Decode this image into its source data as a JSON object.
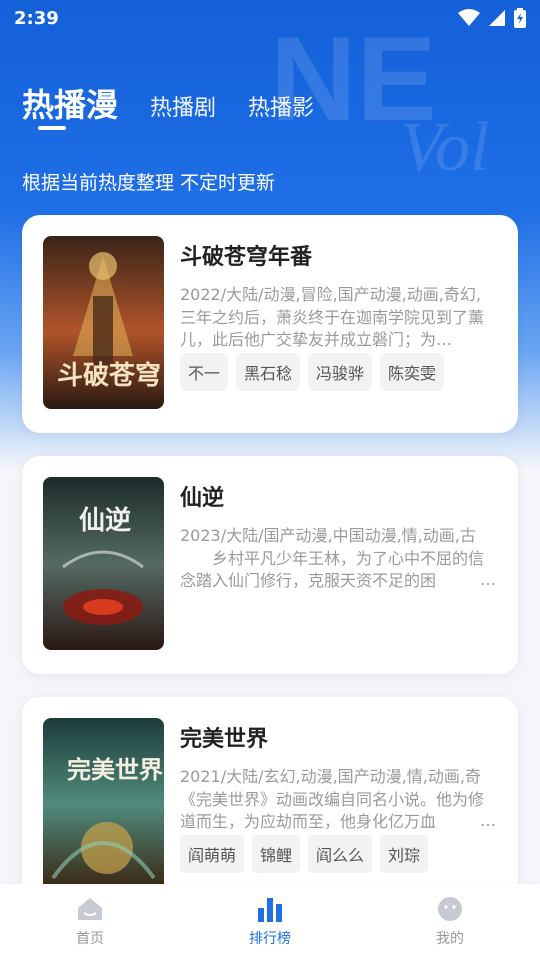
{
  "status_bar": {
    "time": "2:39"
  },
  "tabs": [
    {
      "label": "热播漫",
      "active": true
    },
    {
      "label": "热播剧",
      "active": false
    },
    {
      "label": "热播影",
      "active": false
    }
  ],
  "subtitle": "根据当前热度整理 不定时更新",
  "cards": [
    {
      "title": "斗破苍穹年番",
      "meta": "2022/大陆/动漫,冒险,国产动漫,动画,奇幻,",
      "description": "三年之约后，萧炎终于在迦南学院见到了薰儿，此后他广交挚友并成立磐门；为…",
      "tags": [
        "不一",
        "黑石稔",
        "冯骏骅",
        "陈奕雯"
      ],
      "poster_colors": [
        "#3a2418",
        "#b0542a",
        "#e3b45a"
      ]
    },
    {
      "title": "仙逆",
      "meta": "2023/大陆/国产动漫,中国动漫,情,动画,古",
      "description": "　　乡村平凡少年王林，为了心中不屈的信念踏入仙门修行，克服天资不足的困",
      "ellipsis": "…",
      "tags": [],
      "poster_colors": [
        "#1c2b2a",
        "#556a63",
        "#8b1a12"
      ]
    },
    {
      "title": "完美世界",
      "meta": "2021/大陆/玄幻,动漫,国产动漫,情,动画,奇",
      "description": "《完美世界》动画改编自同名小说。他为修道而生，为应劫而至，他身化亿万血",
      "ellipsis": "…",
      "tags": [
        "阎萌萌",
        "锦鲤",
        "阎么么",
        "刘琮"
      ],
      "poster_colors": [
        "#1d3c3a",
        "#4f8b7c",
        "#c9a44a"
      ]
    }
  ],
  "bottom_nav": [
    {
      "label": "首页",
      "icon": "home-icon",
      "active": false
    },
    {
      "label": "排行榜",
      "icon": "bar-chart-icon",
      "active": true
    },
    {
      "label": "我的",
      "icon": "profile-icon",
      "active": false
    }
  ],
  "colors": {
    "accent": "#1f6fe6",
    "hero_top": "#1460d8",
    "muted_text": "#9a9a9a"
  }
}
